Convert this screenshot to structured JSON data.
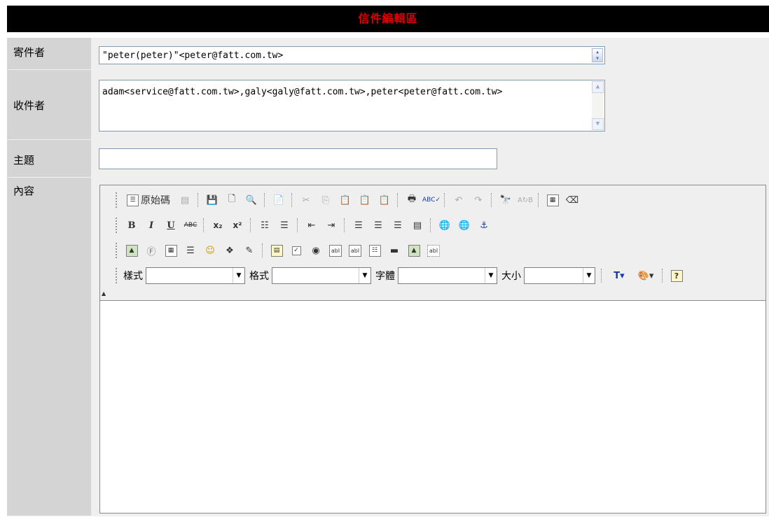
{
  "header": {
    "title": "信件編輯區"
  },
  "fields": {
    "sender": {
      "label": "寄件者",
      "value": "\"peter(peter)\"<peter@fatt.com.tw>"
    },
    "recipients": {
      "label": "收件者",
      "value": "adam<service@fatt.com.tw>,galy<galy@fatt.com.tw>,peter<peter@fatt.com.tw>"
    },
    "subject": {
      "label": "主題",
      "value": ""
    },
    "content": {
      "label": "內容"
    }
  },
  "editor": {
    "source_label": "原始碼",
    "style_label": "樣式",
    "format_label": "格式",
    "font_label": "字體",
    "size_label": "大小",
    "icons_row1": [
      "source-icon",
      "templates-icon",
      "save-icon",
      "new-page-icon",
      "preview-icon",
      "paste-word-icon",
      "cut-icon",
      "copy-icon",
      "paste-icon",
      "paste-text-icon",
      "paste-word2-icon",
      "print-icon",
      "spellcheck-icon",
      "undo-icon",
      "redo-icon",
      "find-icon",
      "replace-icon",
      "select-all-icon",
      "remove-format-icon"
    ],
    "icons_row2": [
      "bold-icon",
      "italic-icon",
      "underline-icon",
      "strike-icon",
      "subscript-icon",
      "superscript-icon",
      "ordered-list-icon",
      "unordered-list-icon",
      "outdent-icon",
      "indent-icon",
      "align-left-icon",
      "align-center-icon",
      "align-right-icon",
      "justify-icon",
      "link-icon",
      "unlink-icon",
      "anchor-icon"
    ],
    "icons_row3": [
      "image-icon",
      "flash-icon",
      "table-icon",
      "rule-icon",
      "smiley-icon",
      "special-char-icon",
      "page-break-icon",
      "form-icon",
      "checkbox-icon",
      "radio-icon",
      "textfield-icon",
      "textarea-icon",
      "select-icon",
      "button-icon",
      "image-button-icon",
      "hidden-field-icon"
    ]
  }
}
